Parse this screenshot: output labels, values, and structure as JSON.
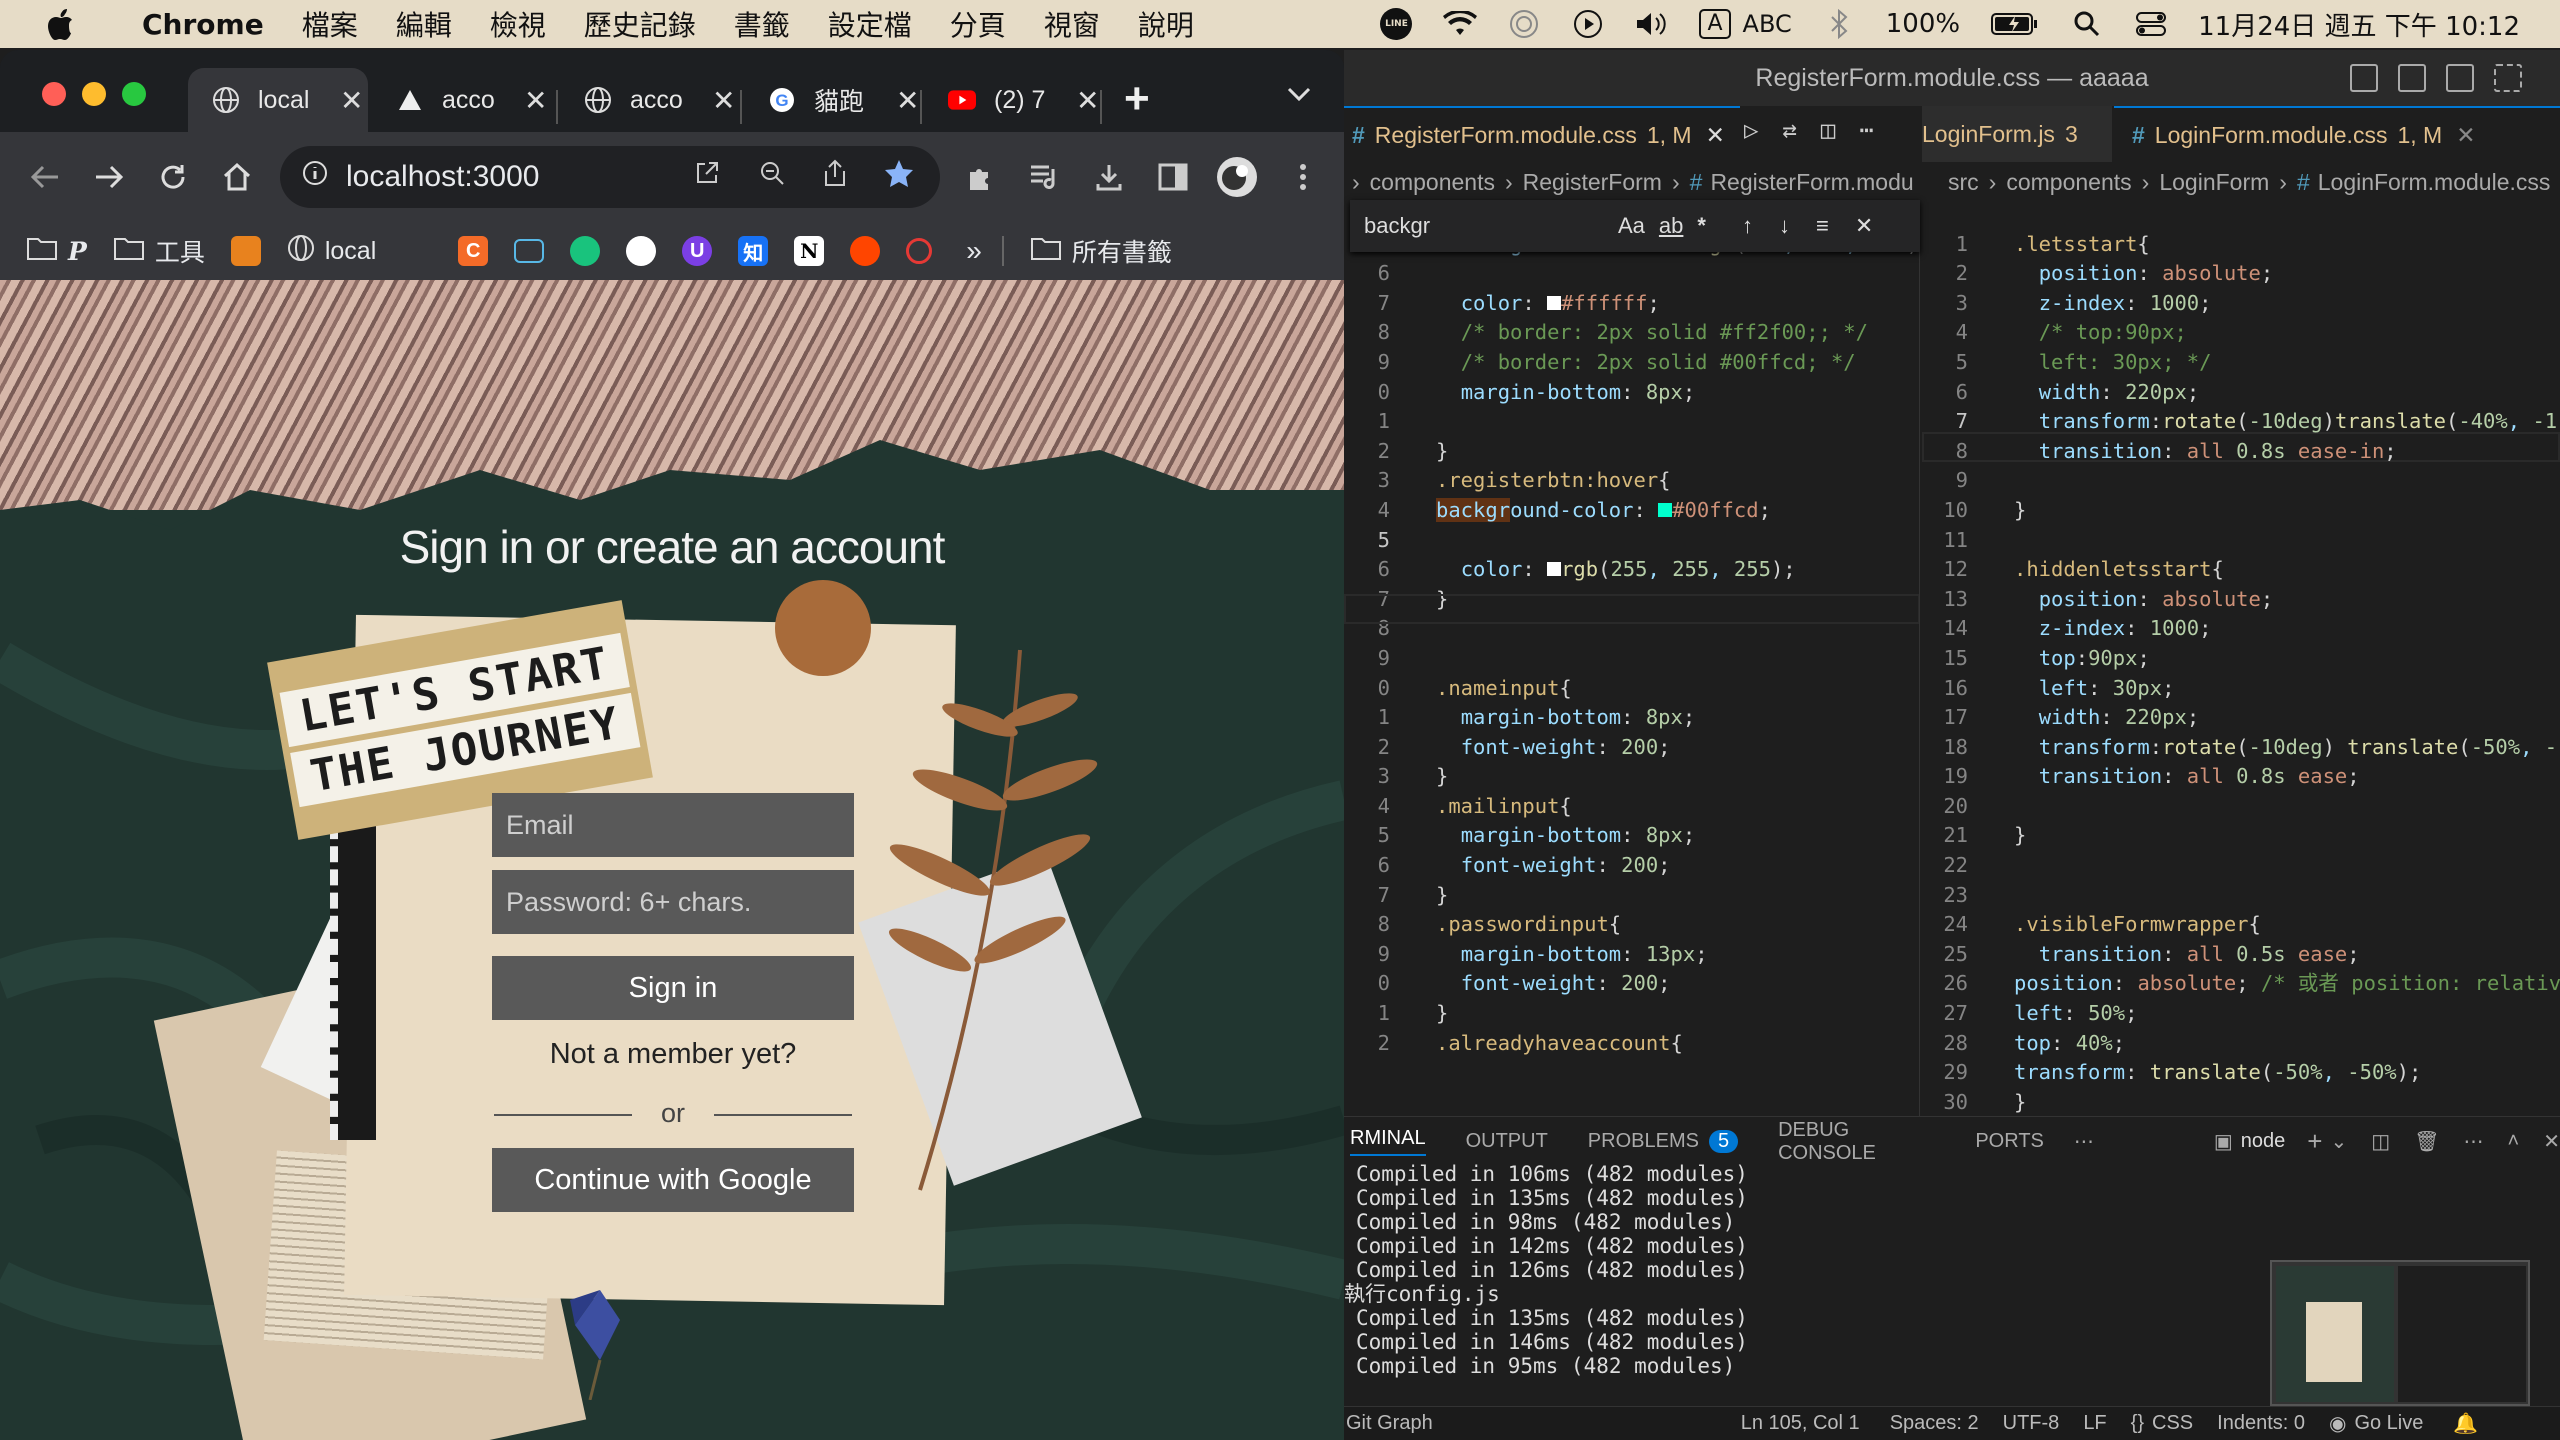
{
  "menubar": {
    "app": "Chrome",
    "items": [
      "檔案",
      "編輯",
      "檢視",
      "歷史記錄",
      "書籤",
      "設定檔",
      "分頁",
      "視窗",
      "說明"
    ],
    "right": {
      "line_badge": "LINE",
      "input": "A",
      "input_name": "ABC",
      "battery": "100%",
      "datetime": "11月24日 週五 下午 10:12"
    }
  },
  "chrome": {
    "tabs": [
      {
        "title": "local",
        "active": true
      },
      {
        "title": "acco"
      },
      {
        "title": "acco"
      },
      {
        "title": "貓跑"
      },
      {
        "title": "(2) 7"
      }
    ],
    "new_tab": "+",
    "url": "localhost:3000",
    "bookmarks": [
      {
        "label": "P"
      },
      {
        "label": "工具"
      },
      {
        "label": ""
      },
      {
        "label": "local"
      },
      {
        "label": ""
      },
      {
        "label": "C"
      },
      {
        "label": ""
      },
      {
        "label": ""
      },
      {
        "label": ""
      },
      {
        "label": "U"
      },
      {
        "label": "知"
      },
      {
        "label": "N"
      },
      {
        "label": ""
      },
      {
        "label": ""
      }
    ],
    "bookmarks_more": "»",
    "all_bookmarks": "所有書籤"
  },
  "page": {
    "title": "Sign in or create an account",
    "collage_line1": "LET'S  START",
    "collage_line2": "THE  JOURNEY",
    "email_placeholder": "Email",
    "password_placeholder": "Password: 6+ chars.",
    "sign_in": "Sign in",
    "not_member": "Not a member yet?",
    "or": "or",
    "google": "Continue with Google"
  },
  "vscode": {
    "window_title": "RegisterForm.module.css — aaaaa",
    "left_tab": {
      "name": "RegisterForm.module.css",
      "badge": "1, M"
    },
    "right_tabs": [
      {
        "name": "LoginForm.js",
        "badge": "3"
      },
      {
        "name": "LoginForm.module.css",
        "badge": "1, M"
      }
    ],
    "left_crumb": [
      "components",
      "RegisterForm",
      "RegisterForm.modu"
    ],
    "right_crumb": [
      "src",
      "components",
      "LoginForm",
      "LoginForm.module.css"
    ],
    "find_text": "backgr",
    "find_opts": [
      "Aa",
      "ab",
      "*"
    ],
    "panel_tabs": [
      "RMINAL",
      "OUTPUT",
      "PROBLEMS",
      "DEBUG CONSOLE",
      "PORTS"
    ],
    "problems_count": "5",
    "shell": "node",
    "terminal": [
      "Compiled in 106ms (482 modules)",
      "Compiled in 135ms (482 modules)",
      "Compiled in 98ms (482 modules)",
      "Compiled in 142ms (482 modules)",
      "Compiled in 126ms (482 modules)",
      "執行config.js",
      "Compiled in 135ms (482 modules)",
      "Compiled in 146ms (482 modules)",
      "Compiled in 95ms (482 modules)"
    ],
    "status": {
      "git": "Git Graph",
      "pos": "Ln 105, Col 1",
      "spaces": "Spaces: 2",
      "enc": "UTF-8",
      "eol": "LF",
      "lang": "CSS",
      "indents": "Indents: 0",
      "golive": "Go Live"
    }
  }
}
